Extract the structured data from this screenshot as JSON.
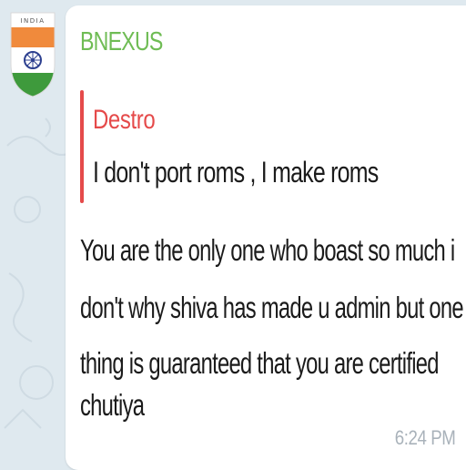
{
  "avatar": {
    "badge_text": "INDIA",
    "icon": "india-flag-icon"
  },
  "message": {
    "sender": "BNEXUS",
    "reply": {
      "author": "Destro",
      "text": "I don't port roms , I make roms"
    },
    "lines": [
      "You are the only one who boast so  much i",
      "don't why shiva has made u admin but one",
      "thing is guaranteed that you are certified",
      "chutiya"
    ],
    "time": "6:24 PM"
  },
  "colors": {
    "sender": "#6fbc54",
    "reply_accent": "#e54a4a",
    "bubble": "#ffffff",
    "background": "#dfe9ef",
    "time": "#a9b2ba"
  }
}
